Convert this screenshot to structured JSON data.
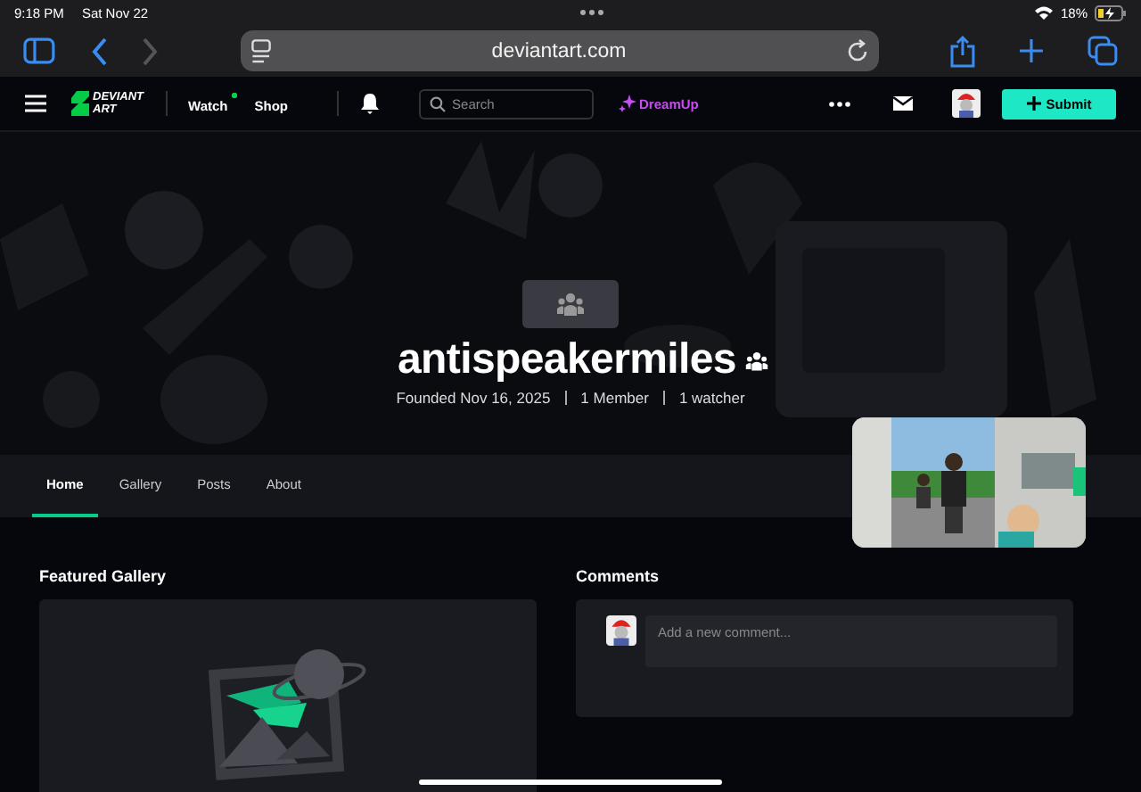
{
  "status_bar": {
    "time": "9:18 PM",
    "date": "Sat Nov 22",
    "battery": "18%"
  },
  "browser": {
    "url": "deviantart.com"
  },
  "site_nav": {
    "logo_lines": [
      "DEVIANT",
      "ART"
    ],
    "links": [
      {
        "label": "Watch",
        "new_activity": true
      },
      {
        "label": "Shop",
        "new_activity": false
      }
    ],
    "search": {
      "placeholder": "Search"
    },
    "dreamup": "DreamUp",
    "submit": "Submit"
  },
  "group": {
    "name": "antispeakermiles",
    "meta": [
      "Founded Nov 16, 2025",
      "1 Member",
      "1 watcher"
    ]
  },
  "tabs": [
    {
      "label": "Home",
      "selected": true
    },
    {
      "label": "Gallery",
      "selected": false
    },
    {
      "label": "Posts",
      "selected": false
    },
    {
      "label": "About",
      "selected": false
    }
  ],
  "featured_gallery": {
    "title": "Featured Gallery"
  },
  "comments": {
    "title": "Comments",
    "placeholder": "Add a new comment..."
  }
}
